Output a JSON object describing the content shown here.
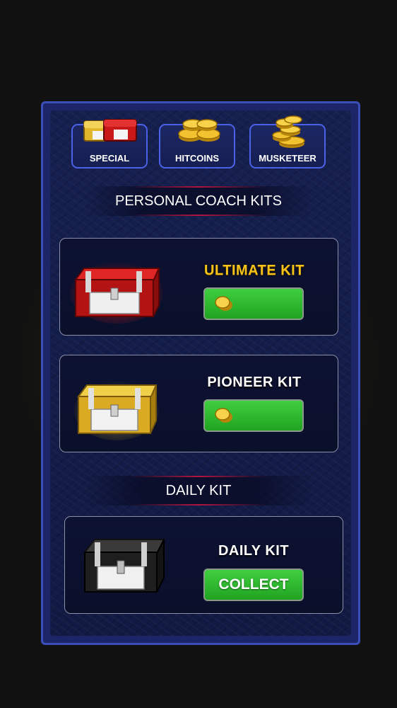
{
  "tabs": [
    {
      "label": "SPECIAL",
      "icon": "chests-icon"
    },
    {
      "label": "HITCOINS",
      "icon": "coins-icon"
    },
    {
      "label": "MUSKETEER",
      "icon": "coin-stack-icon"
    }
  ],
  "sections": {
    "personal_title": "PERSONAL COACH KITS",
    "daily_title": "DAILY KIT"
  },
  "kits": [
    {
      "name": "ULTIMATE KIT",
      "chest": "red-chest-icon",
      "button_icon": "coin-icon",
      "button_label": ""
    },
    {
      "name": "PIONEER KIT",
      "chest": "gold-chest-icon",
      "button_icon": "coin-icon",
      "button_label": ""
    }
  ],
  "daily": {
    "name": "DAILY KIT",
    "chest": "silver-chest-icon",
    "button_label": "COLLECT"
  },
  "colors": {
    "panel_border": "#3c4fb8",
    "tab_border": "#4a62e8",
    "ultimate_name": "#f5c21a",
    "button_green": "#2db82d"
  }
}
